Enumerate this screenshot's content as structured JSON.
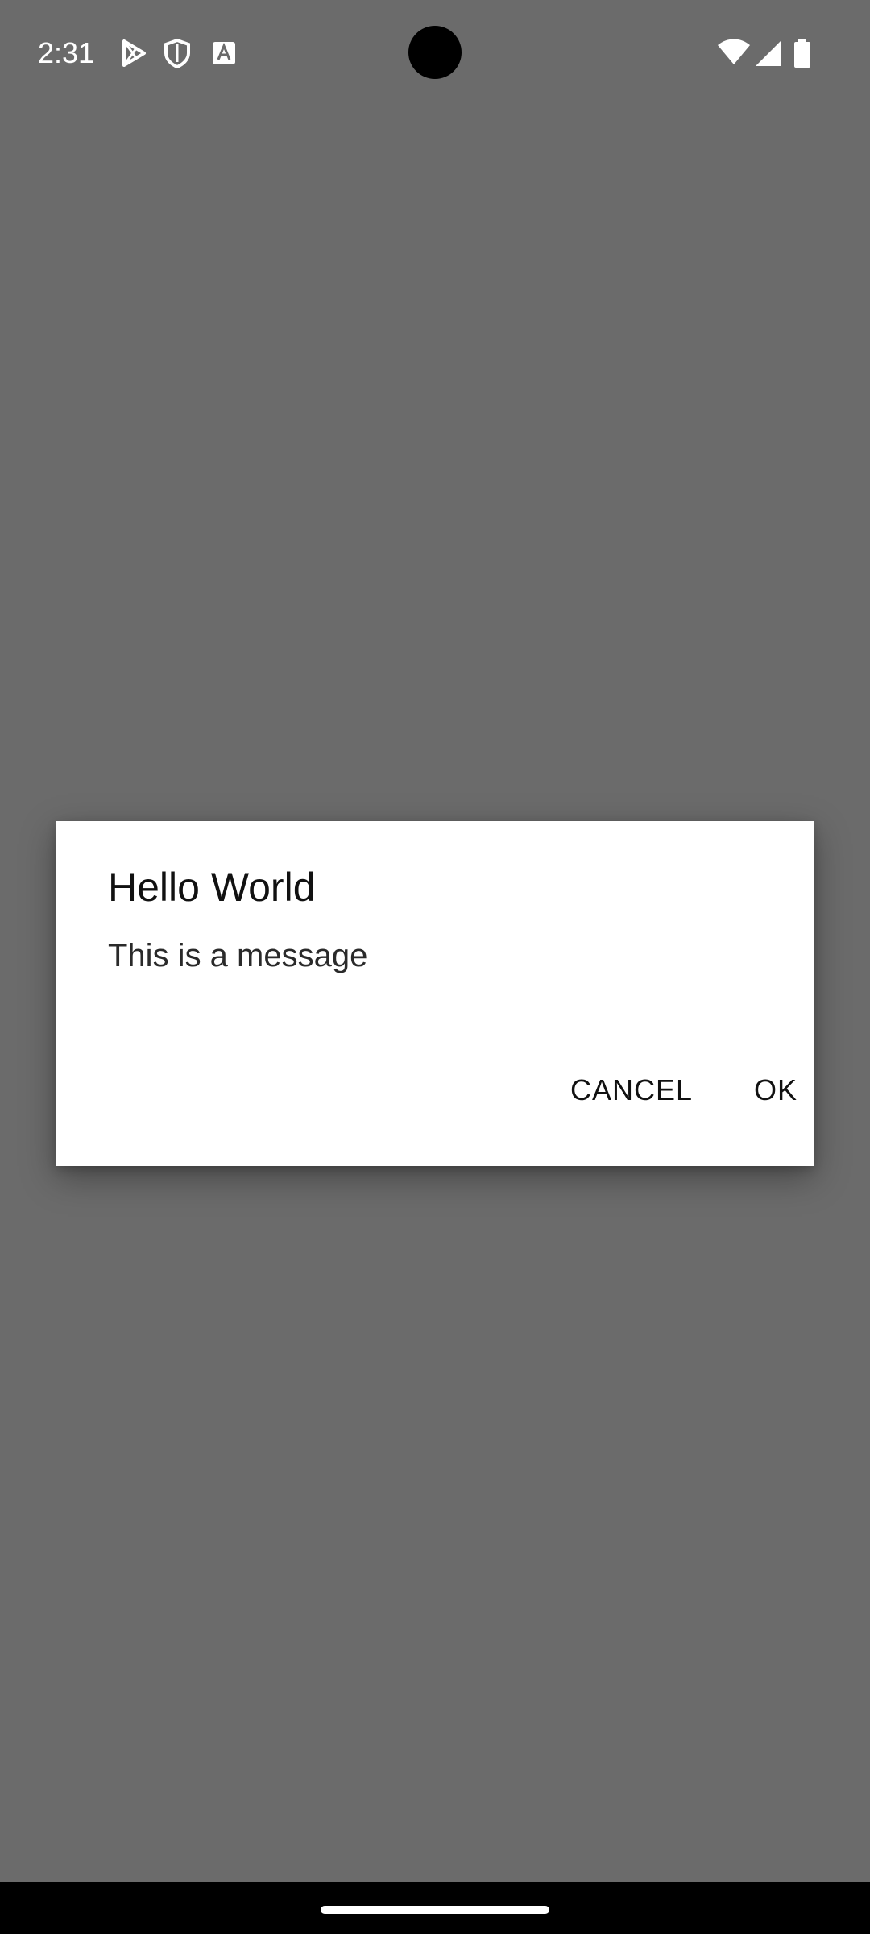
{
  "status_bar": {
    "time": "2:31",
    "notification_icons": [
      "play-store-icon",
      "shield-icon",
      "text-a-icon"
    ],
    "system_icons": [
      "wifi-icon",
      "signal-icon",
      "battery-icon"
    ]
  },
  "dialog": {
    "title": "Hello World",
    "message": "This is a message",
    "buttons": {
      "cancel": "CANCEL",
      "ok": "OK"
    }
  },
  "colors": {
    "scrim": "#6b6b6b",
    "dialog_bg": "#ffffff",
    "text": "#111111",
    "nav_bar": "#000000"
  }
}
